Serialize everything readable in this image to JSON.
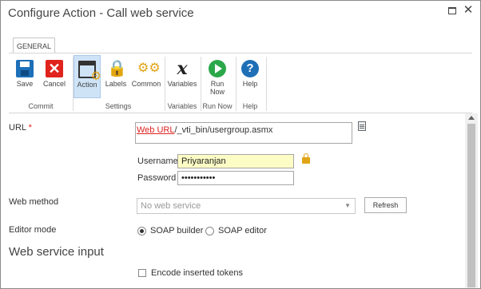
{
  "window": {
    "title": "Configure Action - Call web service",
    "maximize_icon": "maximize-icon",
    "close_glyph": "✕"
  },
  "ribbon": {
    "tab": "GENERAL",
    "buttons": {
      "save": {
        "label": "Save",
        "icon": "save-icon"
      },
      "cancel": {
        "label": "Cancel",
        "icon": "cancel-icon",
        "glyph": "✕"
      },
      "action": {
        "label": "Action",
        "icon": "action-icon"
      },
      "labels": {
        "label": "Labels",
        "icon": "labels-icon",
        "glyph": "🔒"
      },
      "common": {
        "label": "Common",
        "icon": "common-icon",
        "glyph": "⚙⚙"
      },
      "variables": {
        "label": "Variables",
        "icon": "variables-icon",
        "glyph": "x"
      },
      "run_now": {
        "label_line1": "Run",
        "label_line2": "Now",
        "icon": "run-icon"
      },
      "help": {
        "label": "Help",
        "icon": "help-icon",
        "glyph": "?"
      }
    },
    "groups": {
      "commit": "Commit",
      "settings": "Settings",
      "variables": "Variables",
      "run_now": "Run Now",
      "help": "Help"
    }
  },
  "form": {
    "url": {
      "label": "URL",
      "required_mark": "*",
      "token": "Web URL",
      "value_rest": "/_vti_bin/usergroup.asmx"
    },
    "username": {
      "label": "Username",
      "value": "Priyaranjan"
    },
    "password": {
      "label": "Password",
      "value": "•••••••••••"
    },
    "web_method": {
      "label": "Web method",
      "selected": "No web service",
      "refresh_label": "Refresh"
    },
    "editor_mode": {
      "label": "Editor mode",
      "options": [
        "SOAP builder",
        "SOAP editor"
      ],
      "selected": "SOAP builder"
    },
    "section_title": "Web service input",
    "encode_tokens": {
      "label": "Encode inserted tokens",
      "checked": false
    }
  },
  "colors": {
    "accent_blue": "#1d6fb8",
    "cancel_red": "#e0231c",
    "run_green": "#2ba84a",
    "gear_gold": "#e1a416",
    "active_tab_bg": "#cfe3f7",
    "username_bg": "#fcfcc5"
  }
}
